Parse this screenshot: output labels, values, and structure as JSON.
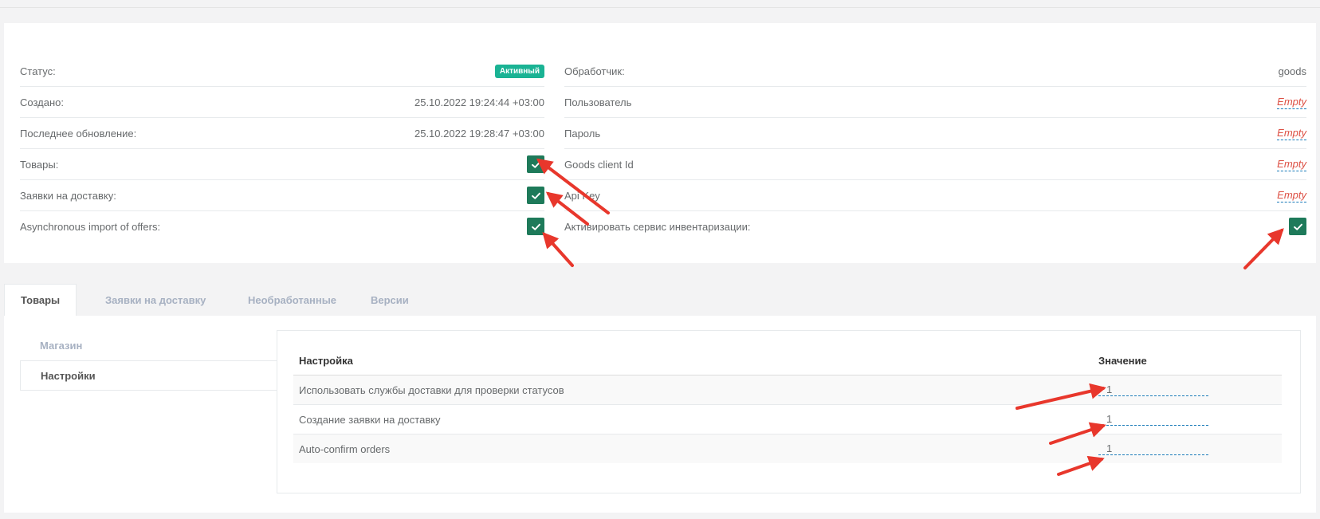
{
  "info": {
    "left": [
      {
        "label": "Статус:",
        "type": "badge",
        "value": "Активный"
      },
      {
        "label": "Создано:",
        "type": "text",
        "value": "25.10.2022 19:24:44 +03:00"
      },
      {
        "label": "Последнее обновление:",
        "type": "text",
        "value": "25.10.2022 19:28:47 +03:00"
      },
      {
        "label": "Товары:",
        "type": "check"
      },
      {
        "label": "Заявки на доставку:",
        "type": "check"
      },
      {
        "label": "Asynchronous import of offers:",
        "type": "check"
      }
    ],
    "right": [
      {
        "label": "Обработчик:",
        "type": "text",
        "value": "goods"
      },
      {
        "label": "Пользователь",
        "type": "empty",
        "value": "Empty"
      },
      {
        "label": "Пароль",
        "type": "empty",
        "value": "Empty"
      },
      {
        "label": "Goods client Id",
        "type": "empty",
        "value": "Empty"
      },
      {
        "label": "Api Key",
        "type": "empty",
        "value": "Empty"
      },
      {
        "label": "Активировать сервис инвентаризации:",
        "type": "check"
      }
    ]
  },
  "tabs": [
    {
      "label": "Товары",
      "active": true
    },
    {
      "label": "Заявки на доставку",
      "active": false
    },
    {
      "label": "Необработанные",
      "active": false
    },
    {
      "label": "Версии",
      "active": false
    }
  ],
  "side_nav": [
    {
      "label": "Магазин",
      "active": false
    },
    {
      "label": "Настройки",
      "active": true
    }
  ],
  "settings_table": {
    "headers": {
      "name": "Настройка",
      "value": "Значение"
    },
    "rows": [
      {
        "name": "Использовать службы доставки для проверки статусов",
        "value": "1"
      },
      {
        "name": "Создание заявки на доставку",
        "value": "1"
      },
      {
        "name": "Auto-confirm orders",
        "value": "1"
      }
    ]
  },
  "colors": {
    "accent": "#1ab394",
    "check": "#1e7a5a",
    "empty_text": "#dd5145",
    "link_underline": "#1a7bb9",
    "annotation_arrow": "#e8372c"
  },
  "icons": {
    "check": "checkmark-icon"
  }
}
